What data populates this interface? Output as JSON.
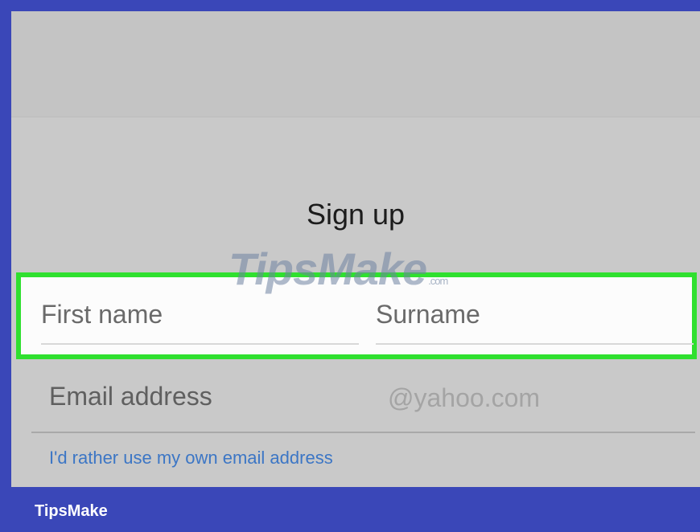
{
  "title": "Sign up",
  "watermark": {
    "text": "TipsMake",
    "suffix": ".com"
  },
  "fields": {
    "first_name_placeholder": "First name",
    "surname_placeholder": "Surname",
    "email_placeholder": "Email address",
    "email_domain": "@yahoo.com"
  },
  "link_text": "I'd rather use my own email address",
  "footer": {
    "brand": "TipsMake"
  },
  "colors": {
    "highlight": "#2fe02f",
    "frame": "#3a47b8",
    "link": "#3c76c5"
  }
}
